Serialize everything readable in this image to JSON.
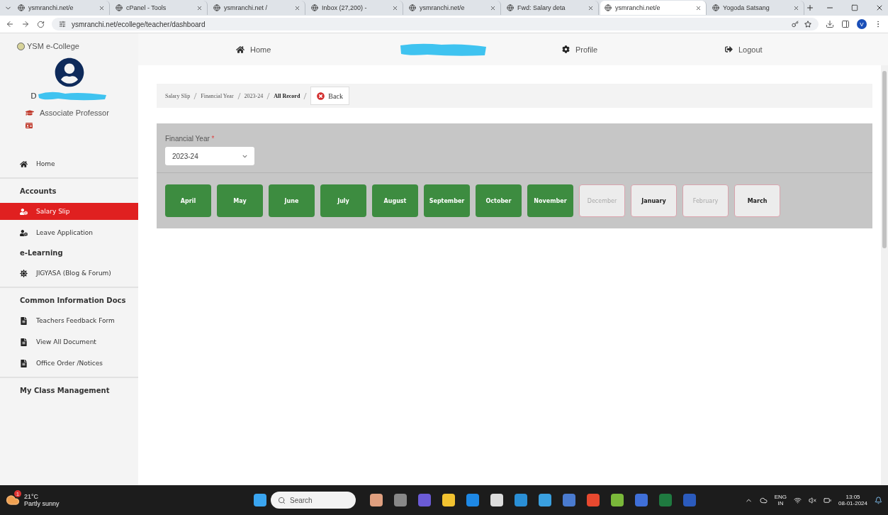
{
  "browser": {
    "tabs": [
      {
        "title": "ysmranchi.net/e",
        "selected": false
      },
      {
        "title": "cPanel - Tools",
        "selected": false
      },
      {
        "title": "ysmranchi.net /",
        "selected": false
      },
      {
        "title": "Inbox (27,200) -",
        "selected": false
      },
      {
        "title": "ysmranchi.net/e",
        "selected": false
      },
      {
        "title": "Fwd: Salary deta",
        "selected": false
      },
      {
        "title": "ysmranchi.net/e",
        "selected": true
      },
      {
        "title": "Yogoda Satsang",
        "selected": false
      }
    ],
    "url": "ysmranchi.net/ecollege/teacher/dashboard",
    "profile_initial": "V"
  },
  "sidebar": {
    "brand": "YSM e-College",
    "user_initial": "D",
    "designation": "Associate Professor",
    "items": [
      {
        "kind": "link",
        "label": "Home",
        "selected": false
      },
      {
        "kind": "heading",
        "label": "Accounts"
      },
      {
        "kind": "link",
        "label": "Salary Slip",
        "selected": true
      },
      {
        "kind": "link",
        "label": "Leave Application",
        "selected": false
      },
      {
        "kind": "heading",
        "label": "e-Learning"
      },
      {
        "kind": "link",
        "label": "JIGYASA (Blog & Forum)",
        "selected": false
      },
      {
        "kind": "heading",
        "label": "Common Information Docs"
      },
      {
        "kind": "link",
        "label": "Teachers Feedback Form",
        "selected": false
      },
      {
        "kind": "link",
        "label": "View All Document",
        "selected": false
      },
      {
        "kind": "link",
        "label": "Office Order /Notices",
        "selected": false
      },
      {
        "kind": "heading",
        "label": "My Class Management"
      }
    ]
  },
  "topnav": [
    "Home",
    "Profile",
    "Logout"
  ],
  "breadcrumb": {
    "items": [
      "Salary Slip",
      "Financial Year",
      "2023-24",
      "All Record"
    ],
    "back": "Back"
  },
  "filter": {
    "label": "Financial Year",
    "required_mark": "*",
    "value": "2023-24"
  },
  "months": [
    {
      "label": "April",
      "available": true,
      "disabled": false
    },
    {
      "label": "May",
      "available": true,
      "disabled": false
    },
    {
      "label": "June",
      "available": true,
      "disabled": false
    },
    {
      "label": "July",
      "available": true,
      "disabled": false
    },
    {
      "label": "August",
      "available": true,
      "disabled": false
    },
    {
      "label": "September",
      "available": true,
      "disabled": false
    },
    {
      "label": "October",
      "available": true,
      "disabled": false
    },
    {
      "label": "November",
      "available": true,
      "disabled": false
    },
    {
      "label": "December",
      "available": false,
      "disabled": true
    },
    {
      "label": "January",
      "available": false,
      "disabled": false
    },
    {
      "label": "February",
      "available": false,
      "disabled": true
    },
    {
      "label": "March",
      "available": false,
      "disabled": false
    }
  ],
  "taskbar": {
    "temperature": "21°C",
    "weather": "Partly sunny",
    "weather_badge": "1",
    "search": "Search",
    "language": "ENG",
    "region": "IN",
    "time": "13:05",
    "date": "08-01-2024"
  }
}
